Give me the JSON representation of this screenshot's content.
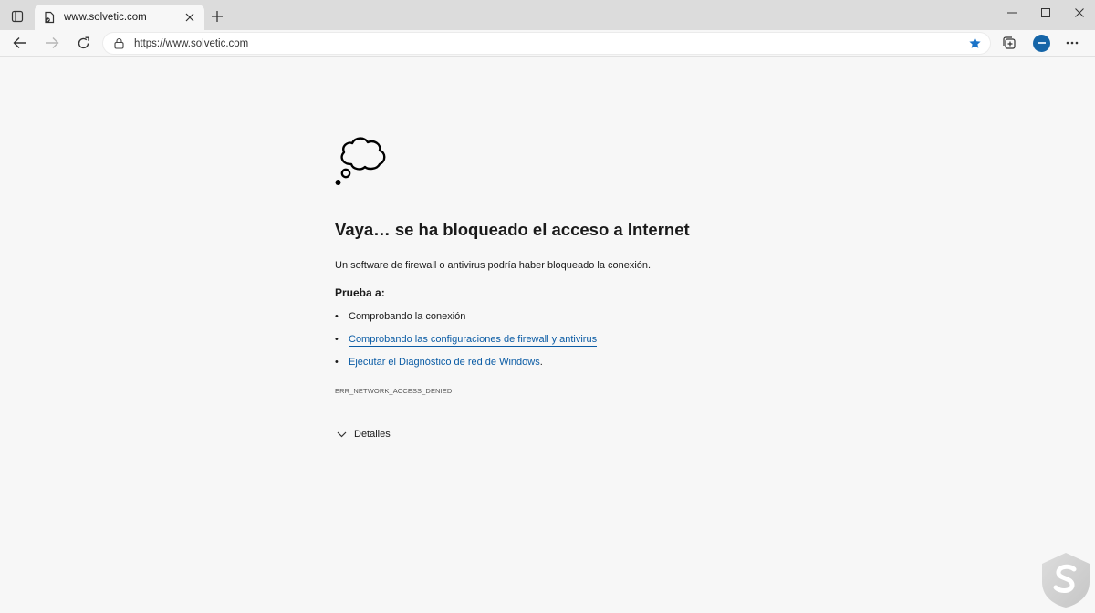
{
  "browser": {
    "tab": {
      "title": "www.solvetic.com"
    },
    "address": {
      "url": "https://www.solvetic.com"
    }
  },
  "icons": {
    "tab_actions": "tab-actions-icon",
    "favicon": "page-favicon-icon",
    "close": "close-icon",
    "new_tab": "plus-icon",
    "back": "arrow-left-icon",
    "forward": "arrow-right-icon",
    "refresh": "refresh-icon",
    "lock": "lock-icon",
    "favorite": "star-icon",
    "collections": "collections-icon",
    "profile": "avatar",
    "more": "ellipsis-icon",
    "error_illustration": "thought-cloud-icon",
    "details": "chevron-down-icon"
  },
  "error_page": {
    "heading": "Vaya… se ha bloqueado el acceso a Internet",
    "description": "Un software de firewall o antivirus podría haber bloqueado la conexión.",
    "try_label": "Prueba a:",
    "suggestions": [
      {
        "text": "Comprobando la conexión",
        "is_link": false
      },
      {
        "text": "Comprobando las configuraciones de firewall y antivirus",
        "is_link": true
      },
      {
        "text": "Ejecutar el Diagnóstico de red de Windows",
        "is_link": true,
        "suffix": "."
      }
    ],
    "error_code": "ERR_NETWORK_ACCESS_DENIED",
    "details_label": "Detalles"
  },
  "colors": {
    "accent_link": "#0b5ca5",
    "favorite_star": "#1a73c8",
    "profile_avatar": "#1565a8",
    "page_background": "#f7f7f7",
    "tabstrip_background": "#dcdcdc"
  }
}
